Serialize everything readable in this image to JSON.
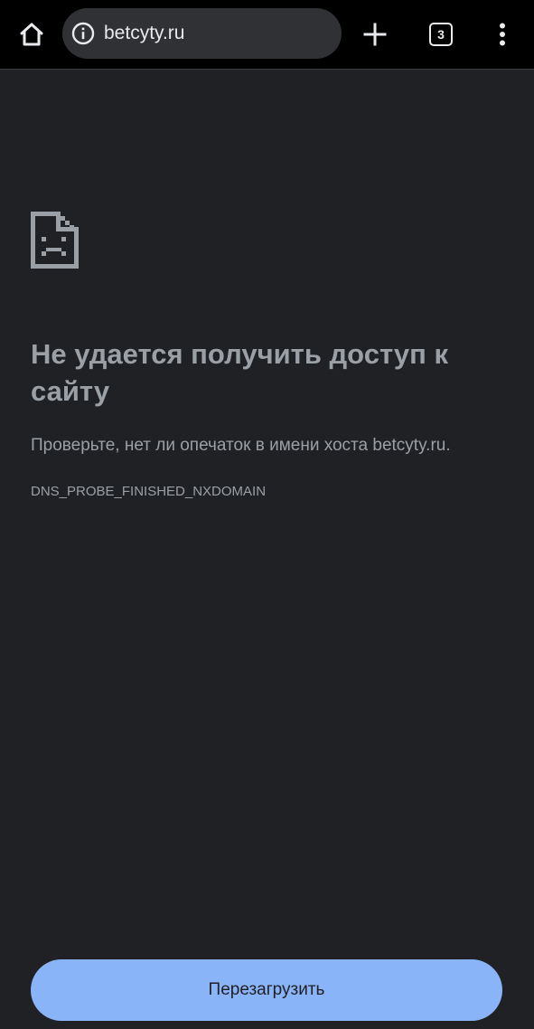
{
  "toolbar": {
    "url": "betcyty.ru",
    "tab_count": "3",
    "icons": {
      "home": "home-icon",
      "info": "info-icon",
      "new_tab": "plus-icon",
      "tabs": "tab-switcher-icon",
      "menu": "kebab-menu-icon"
    }
  },
  "error": {
    "icon": "sad-page-icon",
    "title": "Не удается получить доступ к сайту",
    "description": "Проверьте, нет ли опечаток в имени хоста betcyty.ru.",
    "code": "DNS_PROBE_FINISHED_NXDOMAIN",
    "reload_label": "Перезагрузить"
  },
  "colors": {
    "toolbar_bg": "#000000",
    "page_bg": "#202124",
    "omnibox_bg": "#303134",
    "text_secondary": "#9aa0a6",
    "button_bg": "#8ab4f8"
  }
}
